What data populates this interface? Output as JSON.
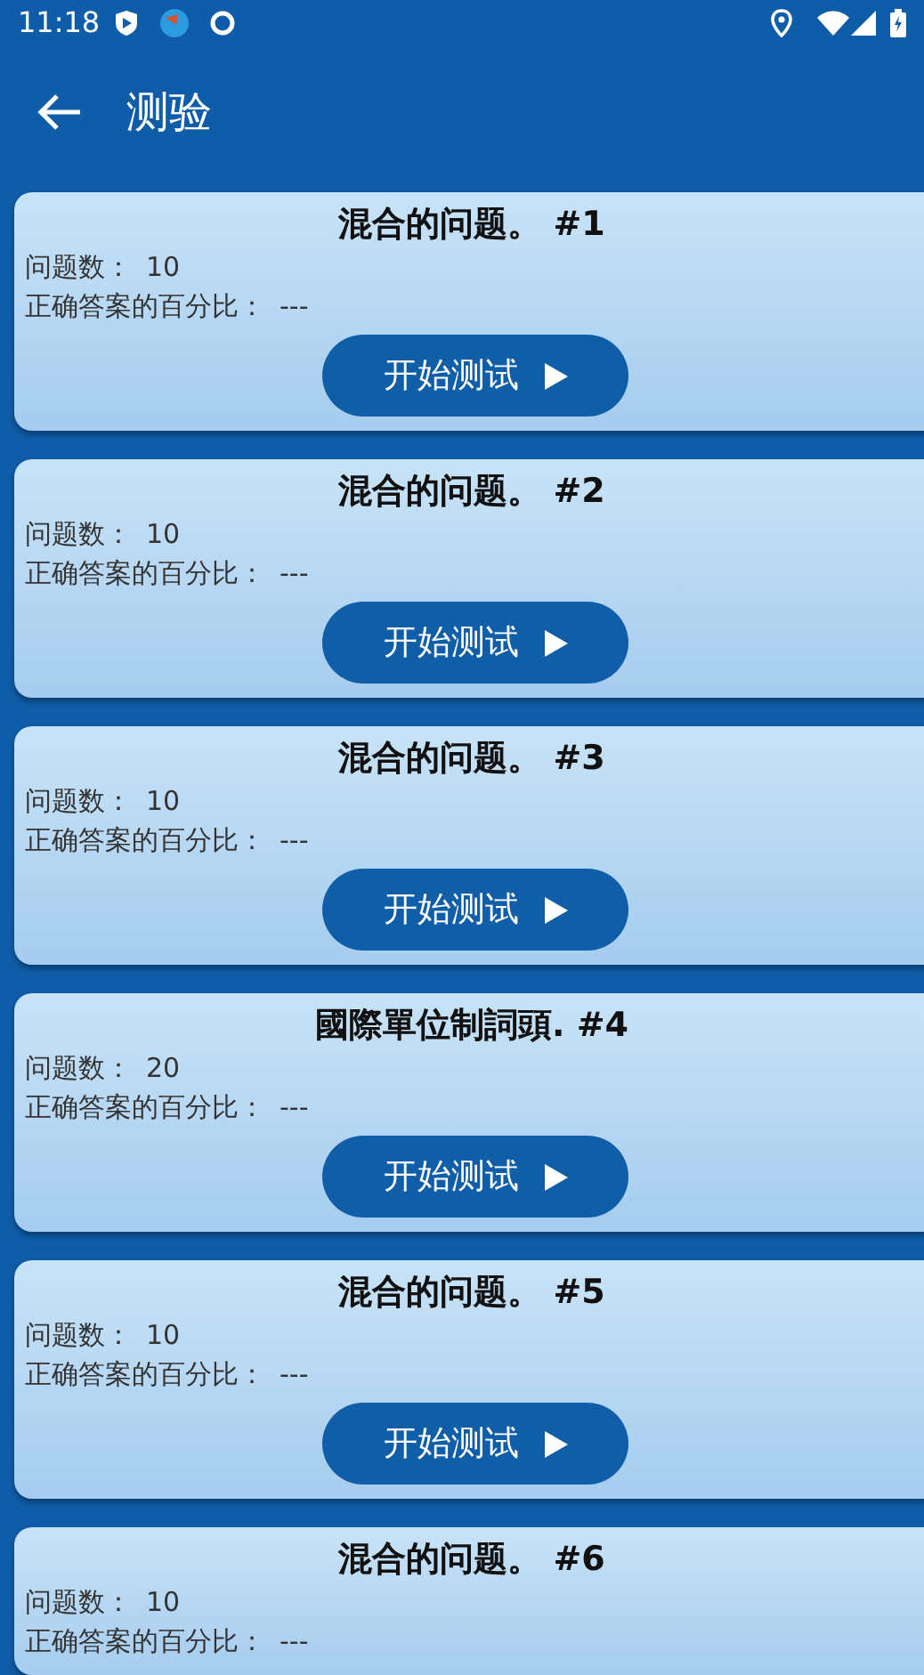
{
  "status_bar": {
    "time": "11:18"
  },
  "app_bar": {
    "title": "测验"
  },
  "quizzes": [
    {
      "title": "混合的问题。 #1",
      "count_label": "问题数：",
      "count": "10",
      "percent_label": "正确答案的百分比：",
      "percent": "---",
      "button": "开始测试"
    },
    {
      "title": "混合的问题。 #2",
      "count_label": "问题数：",
      "count": "10",
      "percent_label": "正确答案的百分比：",
      "percent": "---",
      "button": "开始测试"
    },
    {
      "title": "混合的问题。 #3",
      "count_label": "问题数：",
      "count": "10",
      "percent_label": "正确答案的百分比：",
      "percent": "---",
      "button": "开始测试"
    },
    {
      "title": "國際單位制詞頭. #4",
      "count_label": "问题数：",
      "count": "20",
      "percent_label": "正确答案的百分比：",
      "percent": "---",
      "button": "开始测试"
    },
    {
      "title": "混合的问题。 #5",
      "count_label": "问题数：",
      "count": "10",
      "percent_label": "正确答案的百分比：",
      "percent": "---",
      "button": "开始测试"
    },
    {
      "title": "混合的问题。 #6",
      "count_label": "问题数：",
      "count": "10",
      "percent_label": "正确答案的百分比：",
      "percent": "---"
    }
  ]
}
